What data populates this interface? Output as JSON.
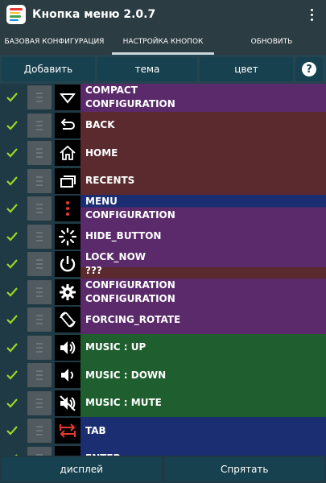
{
  "app": {
    "title": "Кнопка меню 2.0.7",
    "icon": "app-logo-icon"
  },
  "tabs": [
    {
      "label": "БАЗОВАЯ КОНФИГУРАЦИЯ",
      "active": false
    },
    {
      "label": "НАСТРОЙКА КНОПОК",
      "active": true
    },
    {
      "label": "ОБНОВИТЬ",
      "active": false
    }
  ],
  "actions": {
    "add_label": "Добавить",
    "theme_label": "тема",
    "color_label": "цвет",
    "help_label": "?"
  },
  "buttons": [
    {
      "checked": true,
      "icon": "caret-down-icon",
      "lines": [
        "COMPACT",
        "CONFIGURATION"
      ],
      "color": "#5a2a6b"
    },
    {
      "checked": true,
      "icon": "back-icon",
      "lines": [
        "BACK"
      ],
      "color": "#5a2a2e"
    },
    {
      "checked": true,
      "icon": "home-icon",
      "lines": [
        "HOME"
      ],
      "color": "#5a2a2e"
    },
    {
      "checked": true,
      "icon": "recents-icon",
      "lines": [
        "RECENTS"
      ],
      "color": "#5a2a2e"
    },
    {
      "checked": true,
      "icon": "menu-dots-icon",
      "lines": [
        "MENU",
        "CONFIGURATION"
      ],
      "color": "#5a2a6b",
      "top_color": "#1c2e72"
    },
    {
      "checked": true,
      "icon": "spinner-icon",
      "lines": [
        "HIDE_BUTTON"
      ],
      "color": "#5a2a6b"
    },
    {
      "checked": true,
      "icon": "power-icon",
      "lines": [
        "LOCK_NOW",
        "???"
      ],
      "color": "#5a2a6b",
      "bottom_color": "#5a2a2e"
    },
    {
      "checked": true,
      "icon": "gear-icon",
      "lines": [
        "CONFIGURATION",
        "CONFIGURATION"
      ],
      "color": "#5a2a6b"
    },
    {
      "checked": true,
      "icon": "rotate-icon",
      "lines": [
        "FORCING_ROTATE"
      ],
      "color": "#5a2a6b"
    },
    {
      "checked": true,
      "icon": "volume-up-icon",
      "lines": [
        "MUSIC : UP"
      ],
      "color": "#1f5e2e"
    },
    {
      "checked": true,
      "icon": "volume-down-icon",
      "lines": [
        "MUSIC : DOWN"
      ],
      "color": "#1f5e2e"
    },
    {
      "checked": true,
      "icon": "volume-mute-icon",
      "lines": [
        "MUSIC : MUTE"
      ],
      "color": "#1f5e2e"
    },
    {
      "checked": true,
      "icon": "tab-icon",
      "lines": [
        "TAB"
      ],
      "color": "#1c2e72"
    },
    {
      "checked": true,
      "icon": "partial-icon",
      "lines": [
        "ENTER"
      ],
      "color": "#1c2e72"
    }
  ],
  "footer": {
    "display_label": "дисплей",
    "hide_label": "Спрятать"
  },
  "colors": {
    "appbar": "#2b3c42",
    "background": "#1f3a44",
    "button_bg": "#18414f",
    "check": "#9bd62a",
    "purple": "#5a2a6b",
    "maroon": "#5a2a2e",
    "green": "#1f5e2e",
    "blue": "#1c2e72"
  }
}
